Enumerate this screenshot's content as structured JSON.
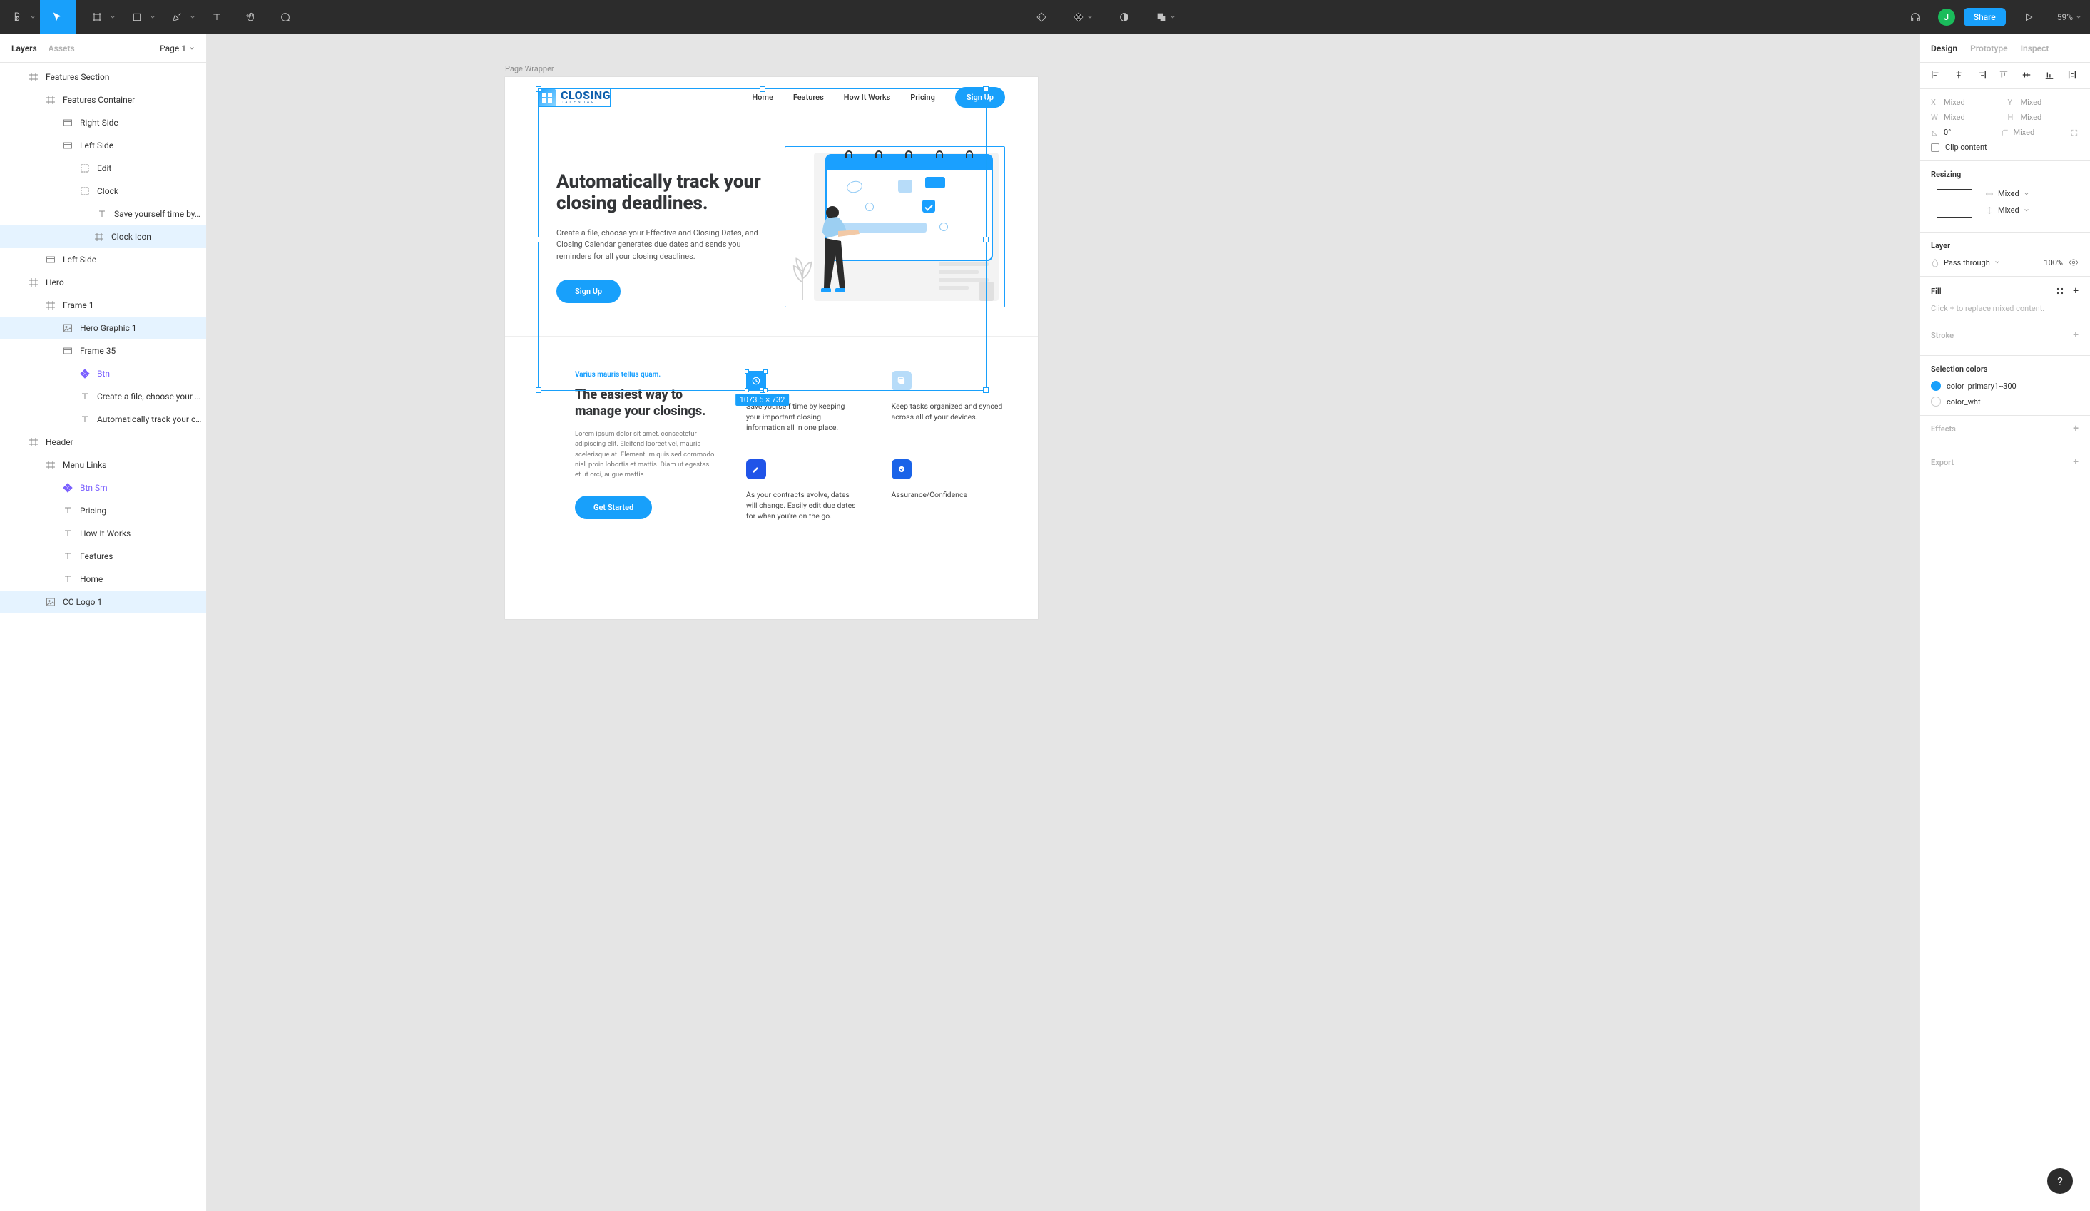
{
  "toolbar": {
    "share": "Share",
    "zoom": "59%",
    "avatar_initial": "J"
  },
  "left_panel": {
    "tabs": {
      "layers": "Layers",
      "assets": "Assets"
    },
    "page_selector": "Page 1",
    "layers": [
      {
        "label": "Features Section",
        "indent": 40,
        "icon": "frame2"
      },
      {
        "label": "Features Container",
        "indent": 64,
        "icon": "frame2"
      },
      {
        "label": "Right Side",
        "indent": 88,
        "icon": "frame"
      },
      {
        "label": "Left Side",
        "indent": 88,
        "icon": "frame"
      },
      {
        "label": "Edit",
        "indent": 112,
        "icon": "group"
      },
      {
        "label": "Clock",
        "indent": 112,
        "icon": "group"
      },
      {
        "label": "Save yourself time by…",
        "indent": 136,
        "icon": "text"
      },
      {
        "label": "Clock Icon",
        "indent": 132,
        "icon": "frame2",
        "selected": true
      },
      {
        "label": "Left Side",
        "indent": 64,
        "icon": "frame"
      },
      {
        "label": "Hero",
        "indent": 40,
        "icon": "frame2"
      },
      {
        "label": "Frame 1",
        "indent": 64,
        "icon": "frame2"
      },
      {
        "label": "Hero Graphic 1",
        "indent": 88,
        "icon": "image",
        "selected": true
      },
      {
        "label": "Frame 35",
        "indent": 88,
        "icon": "frame"
      },
      {
        "label": "Btn",
        "indent": 112,
        "icon": "comp",
        "purple": true
      },
      {
        "label": "Create a file, choose your …",
        "indent": 112,
        "icon": "text"
      },
      {
        "label": "Automatically track your c…",
        "indent": 112,
        "icon": "text"
      },
      {
        "label": "Header",
        "indent": 40,
        "icon": "frame2"
      },
      {
        "label": "Menu Links",
        "indent": 64,
        "icon": "frame2"
      },
      {
        "label": "Btn Sm",
        "indent": 88,
        "icon": "comp",
        "purple": true
      },
      {
        "label": "Pricing",
        "indent": 88,
        "icon": "text"
      },
      {
        "label": "How It Works",
        "indent": 88,
        "icon": "text"
      },
      {
        "label": "Features",
        "indent": 88,
        "icon": "text"
      },
      {
        "label": "Home",
        "indent": 88,
        "icon": "text"
      },
      {
        "label": "CC Logo 1",
        "indent": 64,
        "icon": "image",
        "selected": true
      }
    ]
  },
  "canvas": {
    "frame_label": "Page Wrapper",
    "selection_dim": "1073.5 × 732",
    "page": {
      "logo_text": "CLOSING",
      "logo_sub": "CALENDAR",
      "nav": [
        "Home",
        "Features",
        "How It Works",
        "Pricing"
      ],
      "nav_cta": "Sign Up",
      "hero_title": "Automatically track your closing deadlines.",
      "hero_body": "Create a file, choose your Effective and Closing Dates, and Closing Calendar generates due dates and sends you reminders for all your closing deadlines.",
      "hero_cta": "Sign Up",
      "features": {
        "kicker": "Varius mauris tellus quam.",
        "title": "The easiest way to manage your closings.",
        "body": "Lorem ipsum dolor sit amet, consectetur adipiscing elit. Eleifend laoreet vel, mauris scelerisque at. Elementum quis sed commodo nisl, proin lobortis et mattis. Diam ut egestas et ut orci, augue mattis.",
        "cta": "Get Started",
        "items": [
          {
            "text": "Save yourself time by keeping your important closing information all in one place."
          },
          {
            "text": "Keep tasks organized and synced across all of your devices."
          },
          {
            "text": "As your contracts evolve, dates will change. Easily edit due dates for when you're on the go."
          },
          {
            "text": "Assurance/Confidence"
          }
        ]
      }
    }
  },
  "right_panel": {
    "tabs": {
      "design": "Design",
      "prototype": "Prototype",
      "inspect": "Inspect"
    },
    "transform": {
      "x": "Mixed",
      "y": "Mixed",
      "w": "Mixed",
      "h": "Mixed",
      "rotation": "0°",
      "radius": "Mixed",
      "clip_content": "Clip content"
    },
    "resizing": {
      "title": "Resizing",
      "horizontal": "Mixed",
      "vertical": "Mixed"
    },
    "layer": {
      "title": "Layer",
      "blend": "Pass through",
      "opacity": "100%"
    },
    "fill": {
      "title": "Fill",
      "placeholder": "Click + to replace mixed content."
    },
    "stroke": {
      "title": "Stroke"
    },
    "selection_colors": {
      "title": "Selection colors",
      "items": [
        {
          "swatch": "blue",
          "label": "color_primary1--300"
        },
        {
          "swatch": "white",
          "label": "color_wht"
        }
      ]
    },
    "effects": {
      "title": "Effects"
    },
    "export": {
      "title": "Export"
    }
  },
  "help": "?"
}
